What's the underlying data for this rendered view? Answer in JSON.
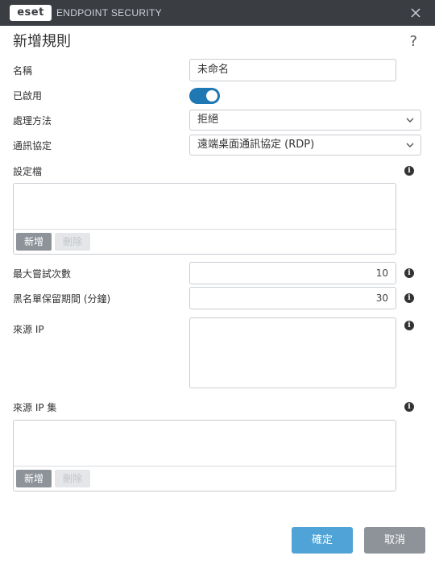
{
  "window": {
    "logo": "eset",
    "app_name": "ENDPOINT SECURITY",
    "close_icon": "close-icon"
  },
  "dialog": {
    "title": "新增規則",
    "help": "?"
  },
  "form": {
    "name_label": "名稱",
    "name_value": "未命名",
    "enabled_label": "已啟用",
    "enabled": true,
    "action_label": "處理方法",
    "action_value": "拒絕",
    "protocol_label": "通訊協定",
    "protocol_value": "遠端桌面通訊協定 (RDP)",
    "profiles_label": "設定檔",
    "profiles_add": "新增",
    "profiles_delete": "刪除",
    "max_attempts_label": "最大嘗試次數",
    "max_attempts_value": "10",
    "blacklist_label": "黑名單保留期間 (分鐘)",
    "blacklist_value": "30",
    "source_ip_label": "來源 IP",
    "source_ip_value": "",
    "source_ip_sets_label": "來源 IP 集",
    "ipsets_add": "新增",
    "ipsets_delete": "刪除"
  },
  "info_icon": "i",
  "footer": {
    "ok": "確定",
    "cancel": "取消"
  },
  "colors": {
    "titlebar": "#3a3d42",
    "toggle_on": "#1f77b4",
    "ok_button": "#4fa3d6",
    "cancel_button": "#8e9399"
  }
}
